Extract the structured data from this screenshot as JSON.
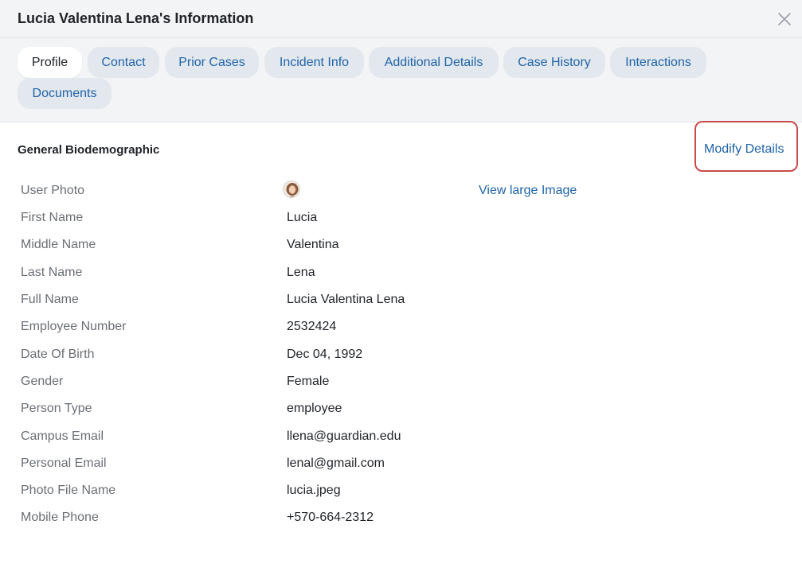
{
  "modal": {
    "title": "Lucia Valentina Lena's Information",
    "close_icon": "close-icon"
  },
  "tabs": [
    {
      "label": "Profile",
      "active": true
    },
    {
      "label": "Contact",
      "active": false
    },
    {
      "label": "Prior Cases",
      "active": false
    },
    {
      "label": "Incident Info",
      "active": false
    },
    {
      "label": "Additional Details",
      "active": false
    },
    {
      "label": "Case History",
      "active": false
    },
    {
      "label": "Interactions",
      "active": false
    },
    {
      "label": "Documents",
      "active": false
    }
  ],
  "section": {
    "title": "General Biodemographic",
    "modify_label": "Modify Details"
  },
  "photo": {
    "label": "User Photo",
    "view_large_label": "View large Image"
  },
  "fields": [
    {
      "label": "First Name",
      "value": "Lucia"
    },
    {
      "label": "Middle Name",
      "value": "Valentina"
    },
    {
      "label": "Last Name",
      "value": "Lena"
    },
    {
      "label": "Full Name",
      "value": "Lucia Valentina Lena"
    },
    {
      "label": "Employee Number",
      "value": "2532424"
    },
    {
      "label": "Date Of Birth",
      "value": "Dec 04, 1992"
    },
    {
      "label": "Gender",
      "value": "Female"
    },
    {
      "label": "Person Type",
      "value": "employee"
    },
    {
      "label": "Campus Email",
      "value": "llena@guardian.edu"
    },
    {
      "label": "Personal Email",
      "value": "lenal@gmail.com"
    },
    {
      "label": "Photo File Name",
      "value": "lucia.jpeg"
    },
    {
      "label": "Mobile Phone",
      "value": "+570-664-2312"
    }
  ],
  "colors": {
    "link": "#1f64a8",
    "highlight_border": "#c94a4a",
    "header_bg": "#f2f4f6",
    "tab_bg": "#e3e8ee"
  }
}
